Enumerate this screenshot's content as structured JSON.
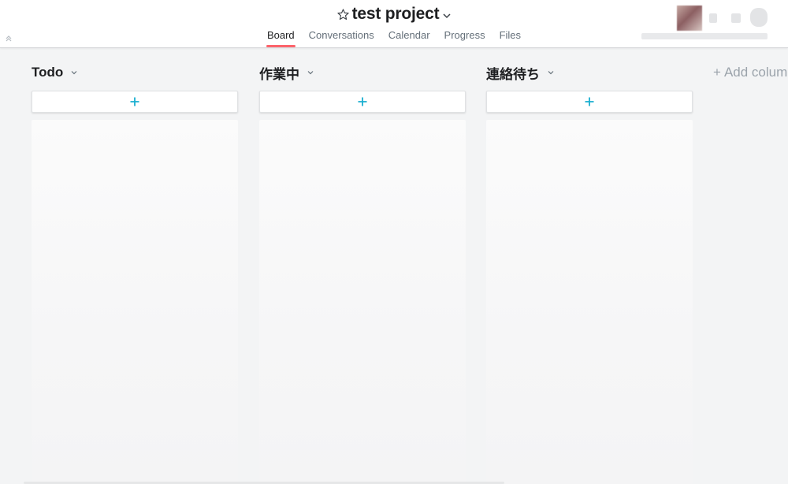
{
  "header": {
    "project_title": "test project",
    "tabs": [
      {
        "label": "Board",
        "active": true
      },
      {
        "label": "Conversations",
        "active": false
      },
      {
        "label": "Calendar",
        "active": false
      },
      {
        "label": "Progress",
        "active": false
      },
      {
        "label": "Files",
        "active": false
      }
    ]
  },
  "board": {
    "columns": [
      {
        "title": "Todo"
      },
      {
        "title": "作業中"
      },
      {
        "title": "連絡待ち"
      }
    ],
    "add_column_label": "Add column"
  },
  "icons": {
    "star": "star-outline-icon",
    "chevron": "chevron-down-icon",
    "plus": "plus-icon",
    "collapse": "double-chevron-up-icon"
  },
  "colors": {
    "accent_tab": "#fc636b",
    "plus": "#1aafd0"
  }
}
